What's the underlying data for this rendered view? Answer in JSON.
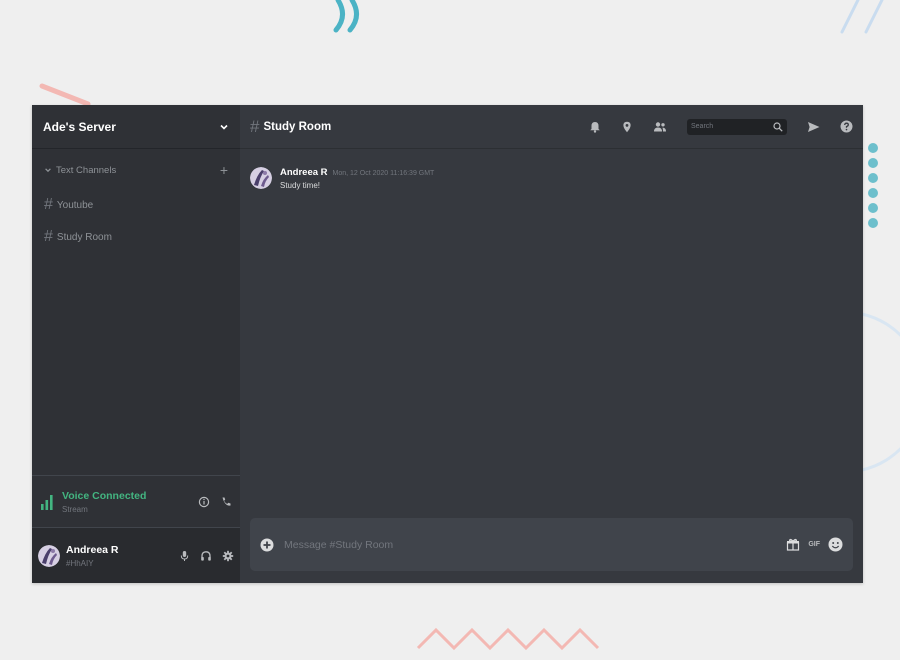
{
  "server": {
    "name": "Ade's Server"
  },
  "category": {
    "label": "Text Channels"
  },
  "channels": [
    {
      "label": "Youtube"
    },
    {
      "label": "Study Room"
    }
  ],
  "voice": {
    "status": "Voice Connected",
    "sub": "Stream"
  },
  "user": {
    "name": "Andreea R",
    "tag": "#HhAIY"
  },
  "header": {
    "channel": "Study Room"
  },
  "search": {
    "placeholder": "Search"
  },
  "messages": [
    {
      "author": "Andreea R",
      "timestamp": "Mon, 12 Oct 2020 11:16:39 GMT",
      "text": "Study time!"
    }
  ],
  "composer": {
    "placeholder": "Message #Study Room",
    "gif_label": "GIF"
  },
  "colors": {
    "accent_green": "#43b581",
    "background": "#36393f",
    "sidebar": "#2f3136"
  }
}
